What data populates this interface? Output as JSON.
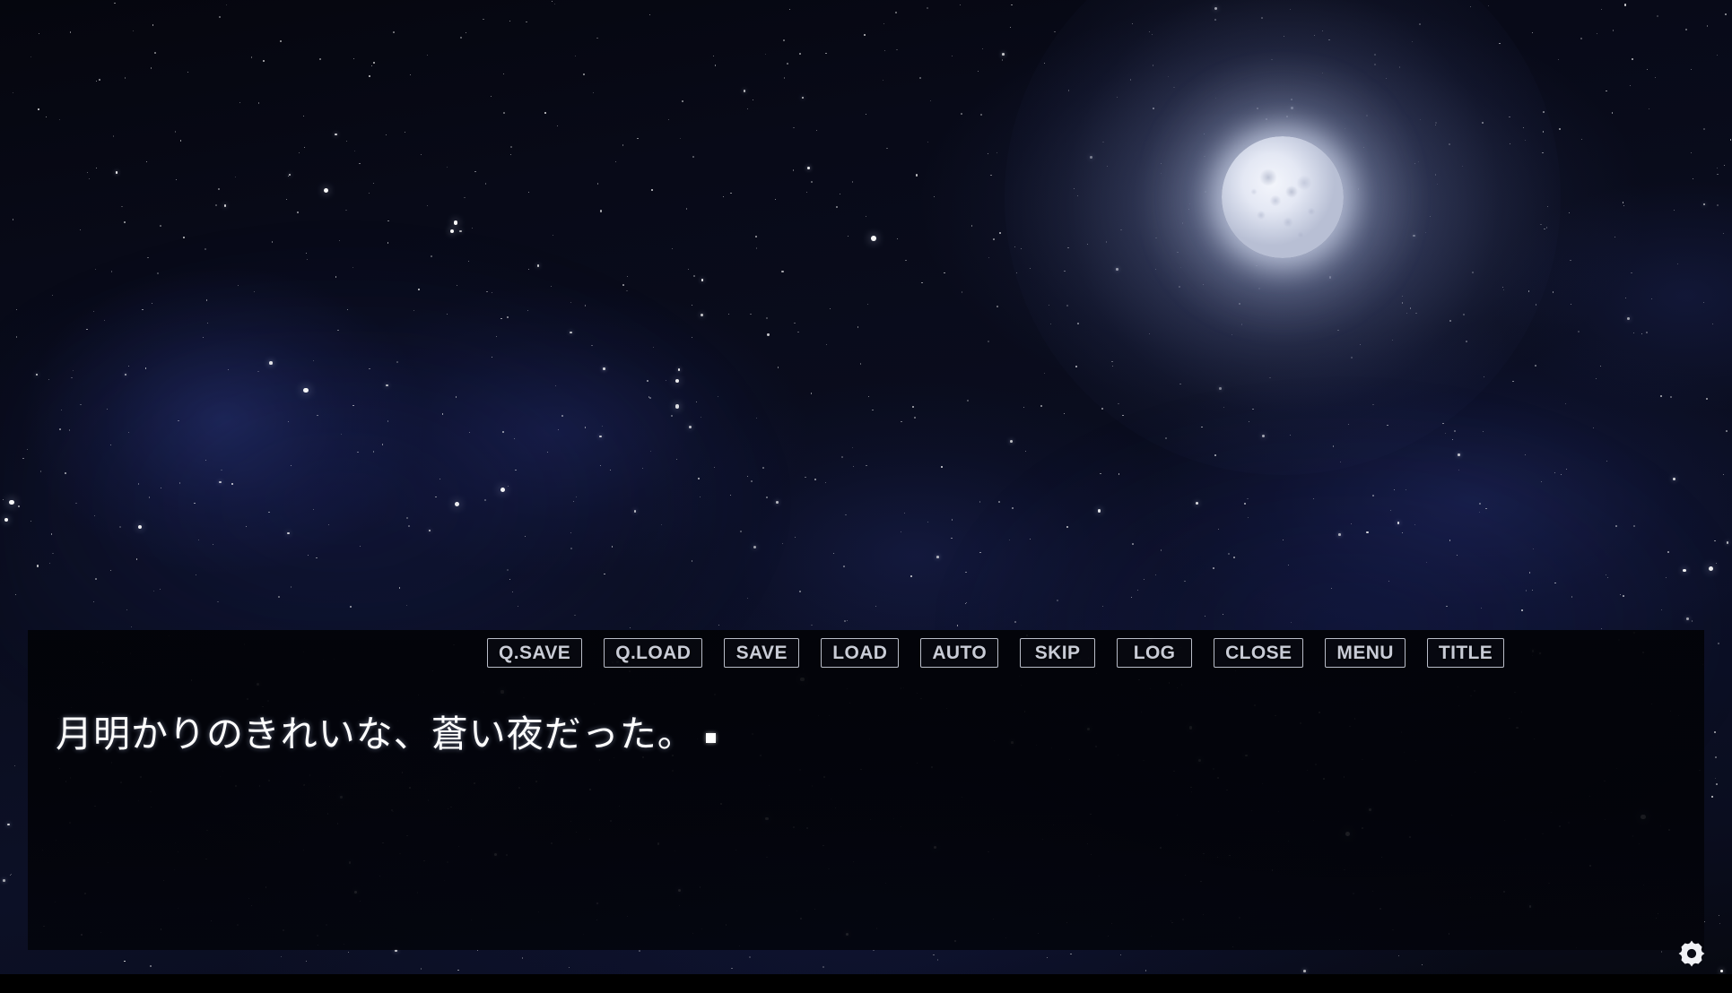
{
  "scene": {
    "name": "moonlit-night-sky",
    "background_description": "starry night sky with nebula clouds and a full moon"
  },
  "moon": {
    "label": "full-moon",
    "color": "#f4f6fc",
    "glow_color": "#ecf1ff"
  },
  "command_bar": {
    "buttons": [
      {
        "id": "quick-save",
        "label": "Q.SAVE"
      },
      {
        "id": "quick-load",
        "label": "Q.LOAD"
      },
      {
        "id": "save",
        "label": "SAVE"
      },
      {
        "id": "load",
        "label": "LOAD"
      },
      {
        "id": "auto",
        "label": "AUTO"
      },
      {
        "id": "skip",
        "label": "SKIP"
      },
      {
        "id": "log",
        "label": "LOG"
      },
      {
        "id": "close",
        "label": "CLOSE"
      },
      {
        "id": "menu",
        "label": "MENU"
      },
      {
        "id": "title",
        "label": "TITLE"
      }
    ],
    "border_color": "#b9bdc8",
    "text_color": "#c9ccd6"
  },
  "dialogue": {
    "speaker": "",
    "text": "月明かりのきれいな、蒼い夜だった。",
    "text_color": "#ffffff",
    "cursor": "click-to-continue-marker"
  },
  "config": {
    "gear_icon": "gear-icon",
    "gear_color": "#f0f1f5"
  }
}
